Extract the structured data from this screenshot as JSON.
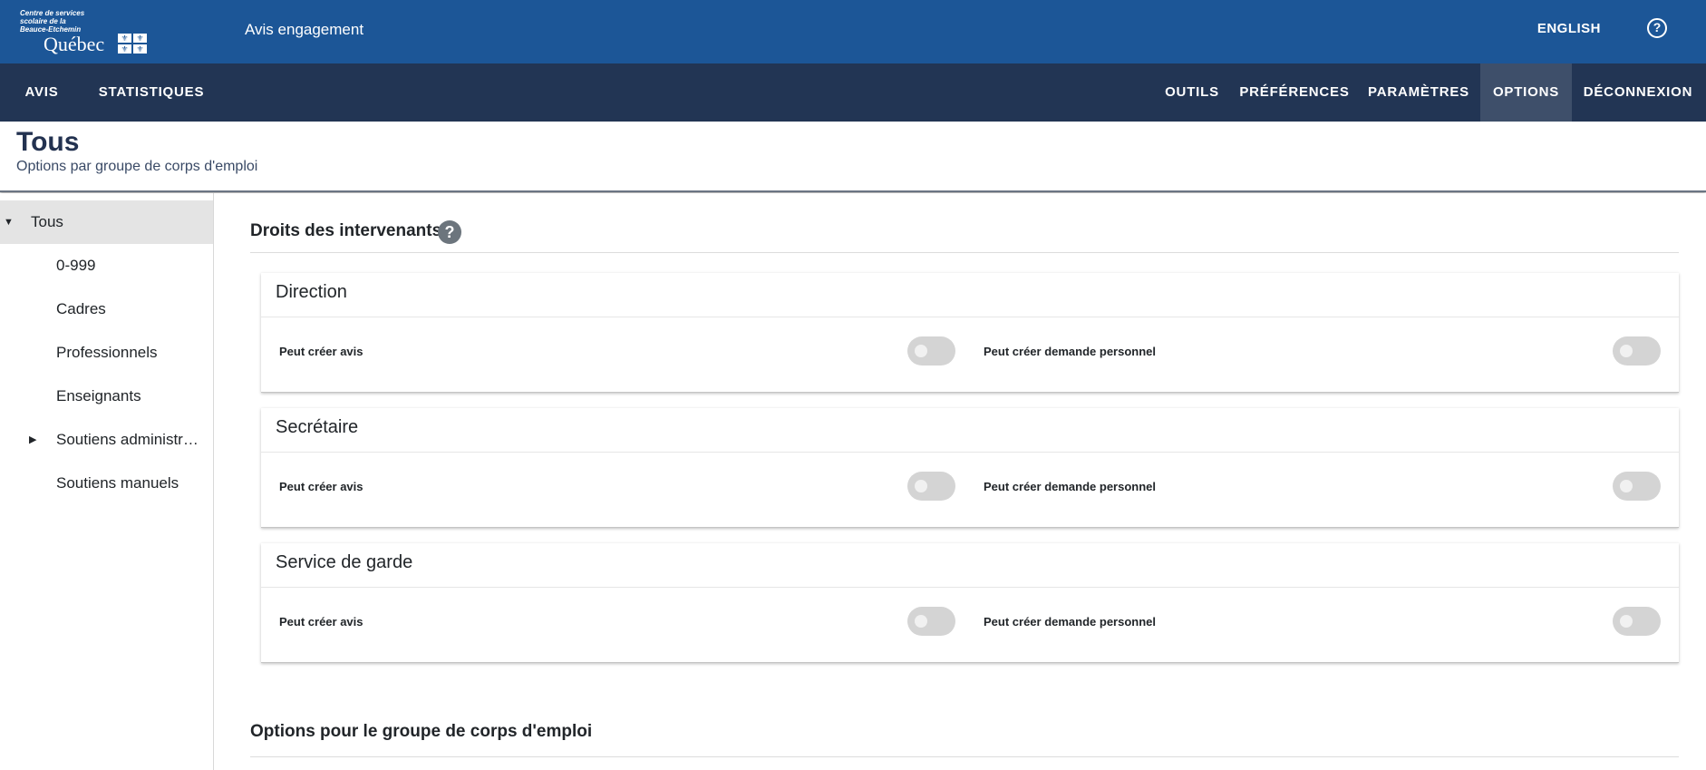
{
  "header": {
    "logo_lines": [
      "Centre de services",
      "scolaire de la",
      "Beauce-Etchemin"
    ],
    "logo_quebec": "Québec",
    "app_title": "Avis engagement",
    "language_link": "ENGLISH",
    "help_icon": "help-circle-icon"
  },
  "nav": {
    "left": [
      "AVIS",
      "STATISTIQUES"
    ],
    "right": [
      "OUTILS",
      "PRÉFÉRENCES",
      "PARAMÈTRES",
      "OPTIONS",
      "DÉCONNEXION"
    ],
    "active": "OPTIONS"
  },
  "page": {
    "title": "Tous",
    "subtitle": "Options par groupe de corps d'emploi"
  },
  "sidebar": {
    "items": [
      {
        "label": "Tous",
        "expanded": true,
        "selected": true
      },
      {
        "label": "0-999"
      },
      {
        "label": "Cadres"
      },
      {
        "label": "Professionnels"
      },
      {
        "label": "Enseignants"
      },
      {
        "label": "Soutiens administratifs",
        "expandable": true
      },
      {
        "label": "Soutiens manuels"
      }
    ]
  },
  "main": {
    "rights_section_title": "Droits des intervenants",
    "cards": [
      {
        "title": "Direction",
        "option1": "Peut créer avis",
        "option1_on": false,
        "option2": "Peut créer demande personnel",
        "option2_on": false
      },
      {
        "title": "Secrétaire",
        "option1": "Peut créer avis",
        "option1_on": false,
        "option2": "Peut créer demande personnel",
        "option2_on": false
      },
      {
        "title": "Service de garde",
        "option1": "Peut créer avis",
        "option1_on": false,
        "option2": "Peut créer demande personnel",
        "option2_on": false
      }
    ],
    "options_section_title": "Options pour le groupe de corps d'emploi"
  }
}
